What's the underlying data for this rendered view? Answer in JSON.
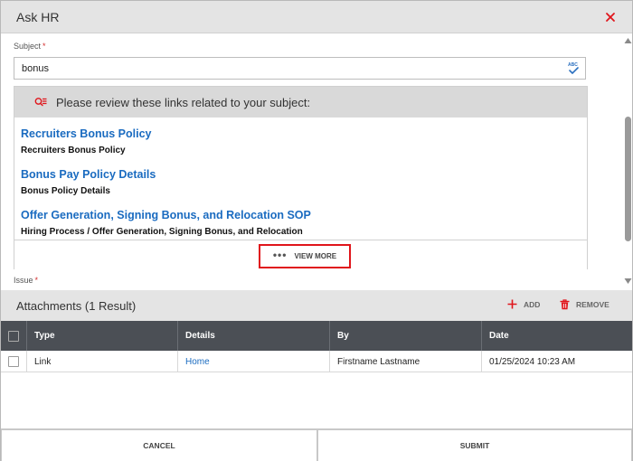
{
  "window": {
    "title": "Ask HR"
  },
  "form": {
    "subject_label": "Subject",
    "required_marker": "*",
    "subject_value": "bonus",
    "issue_label": "Issue"
  },
  "links_panel": {
    "header_text": "Please review these links related to your subject:",
    "links": [
      {
        "title": "Recruiters Bonus Policy",
        "subtitle": "Recruiters Bonus Policy"
      },
      {
        "title": "Bonus Pay Policy Details",
        "subtitle": "Bonus Policy Details"
      },
      {
        "title": "Offer Generation, Signing Bonus, and Relocation SOP",
        "subtitle": "Hiring Process / Offer Generation, Signing Bonus, and Relocation"
      }
    ],
    "view_more_label": "VIEW MORE",
    "view_more_dots": "•••"
  },
  "attachments": {
    "title": "Attachments (1 Result)",
    "add_label": "ADD",
    "remove_label": "REMOVE",
    "columns": [
      "Type",
      "Details",
      "By",
      "Date"
    ],
    "rows": [
      {
        "type": "Link",
        "details": "Home",
        "by": "Firstname Lastname",
        "date": "01/25/2024 10:23 AM"
      }
    ]
  },
  "footer": {
    "cancel_label": "CANCEL",
    "submit_label": "SUBMIT"
  },
  "icons": {
    "close": "close-icon",
    "spellcheck": "spellcheck-icon",
    "review": "review-list-icon",
    "add": "plus-icon",
    "remove": "trash-icon"
  },
  "colors": {
    "accent_red": "#e0151b",
    "link_blue": "#1a6bc0",
    "table_header": "#4b4f55",
    "title_bar": "#e4e4e4"
  }
}
